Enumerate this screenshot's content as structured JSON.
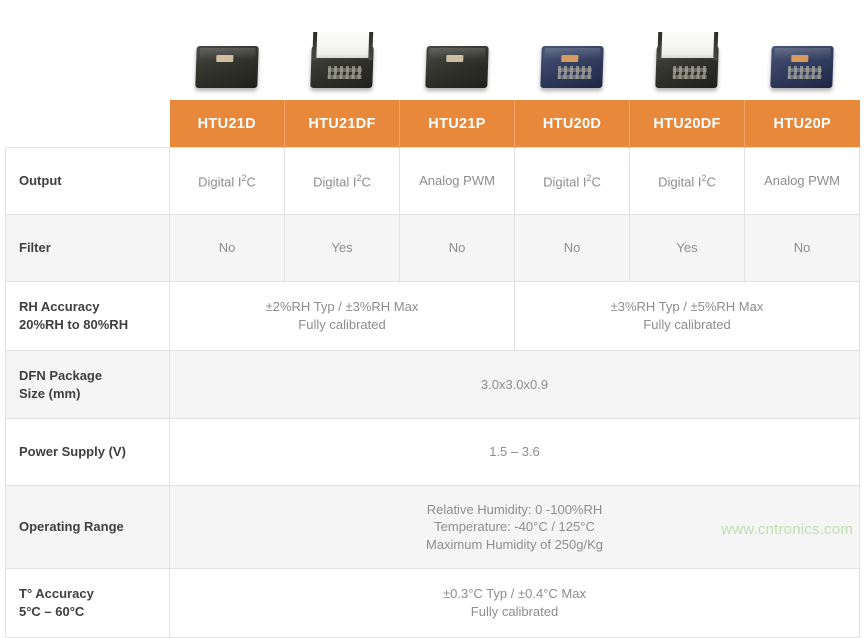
{
  "table": {
    "accent_color": "#E8883A",
    "header_text_color": "#FFFFFF",
    "cell_text_color": "#8D8D8D",
    "label_text_color": "#3F3F3F",
    "columns": [
      {
        "label": "HTU21D",
        "photo": "dfn-sensor-dark-open"
      },
      {
        "label": "HTU21DF",
        "photo": "dfn-sensor-dark-white-filter-cap"
      },
      {
        "label": "HTU21P",
        "photo": "dfn-sensor-dark-open"
      },
      {
        "label": "HTU20D",
        "photo": "dfn-sensor-blue-open"
      },
      {
        "label": "HTU20DF",
        "photo": "dfn-sensor-dark-white-filter-cap"
      },
      {
        "label": "HTU20P",
        "photo": "dfn-sensor-blue-open"
      }
    ],
    "rows": {
      "output": {
        "label": "Output",
        "values": [
          "Digital I2C",
          "Digital I2C",
          "Analog PWM",
          "Digital I2C",
          "Digital I2C",
          "Analog PWM"
        ],
        "values_parts": [
          {
            "pre": "Digital I",
            "sup": "2",
            "post": "C"
          },
          {
            "pre": "Digital I",
            "sup": "2",
            "post": "C"
          },
          {
            "pre": "Analog PWM",
            "sup": "",
            "post": ""
          },
          {
            "pre": "Digital I",
            "sup": "2",
            "post": "C"
          },
          {
            "pre": "Digital I",
            "sup": "2",
            "post": "C"
          },
          {
            "pre": "Analog PWM",
            "sup": "",
            "post": ""
          }
        ]
      },
      "filter": {
        "label": "Filter",
        "values": [
          "No",
          "Yes",
          "No",
          "No",
          "Yes",
          "No"
        ]
      },
      "rh_accuracy": {
        "label": "RH Accuracy\n20%RH to 80%RH",
        "group_left": "±2%RH Typ / ±3%RH Max\nFully calibrated",
        "group_right": "±3%RH Typ / ±5%RH Max\nFully calibrated"
      },
      "dfn_package": {
        "label": "DFN Package\nSize (mm)",
        "value": "3.0x3.0x0.9"
      },
      "power_supply": {
        "label": "Power Supply (V)",
        "value": "1.5 – 3.6"
      },
      "operating_range": {
        "label": "Operating Range",
        "value": "Relative Humidity: 0 -100%RH\nTemperature: -40°C / 125°C\nMaximum Humidity of 250g/Kg"
      },
      "t_accuracy": {
        "label": "T° Accuracy\n5°C – 60°C",
        "value": "±0.3°C Typ / ±0.4°C Max\nFully calibrated"
      }
    }
  },
  "watermark": {
    "text": "www.cntronics.com",
    "color": "#BFE0B0"
  }
}
